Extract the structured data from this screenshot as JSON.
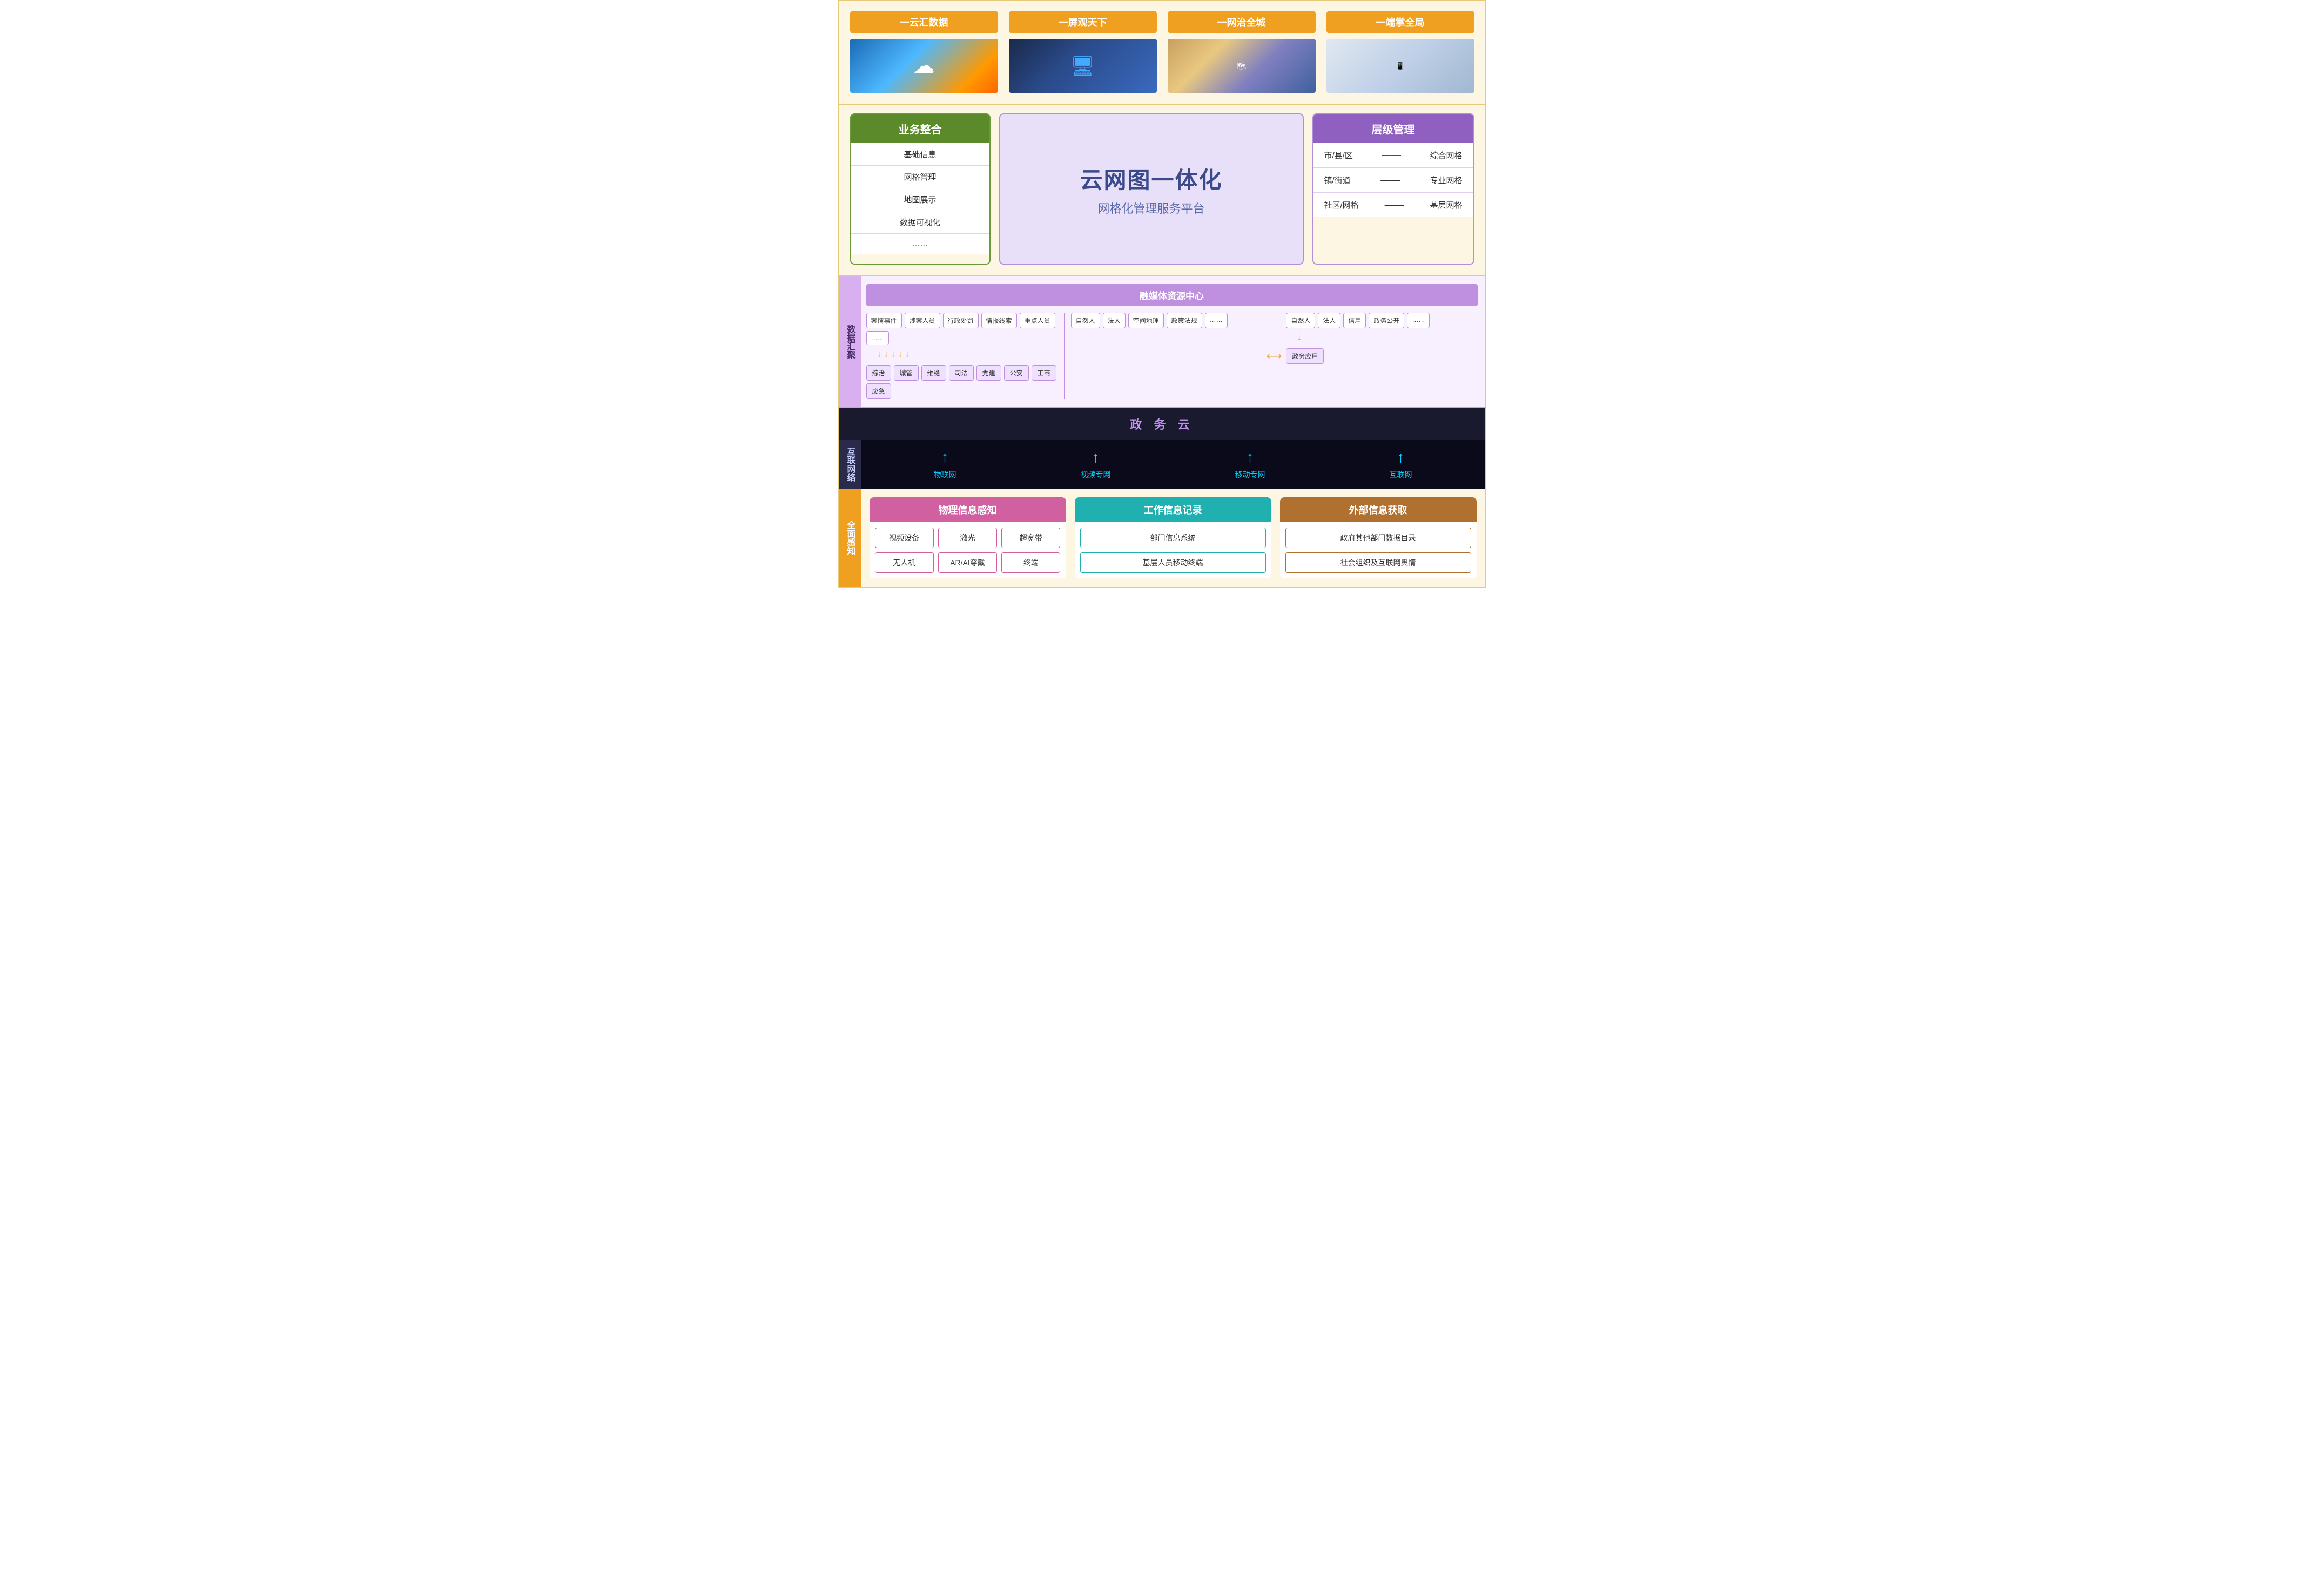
{
  "top": {
    "cards": [
      {
        "title": "一云汇数据",
        "img_type": "cloud"
      },
      {
        "title": "一屏观天下",
        "img_type": "screen"
      },
      {
        "title": "一网治全城",
        "img_type": "map"
      },
      {
        "title": "一端掌全局",
        "img_type": "mobile"
      }
    ]
  },
  "business": {
    "header": "业务整合",
    "items": [
      "基础信息",
      "网格管理",
      "地图展示",
      "数据可视化",
      "……"
    ]
  },
  "center": {
    "title_main": "云网图一体化",
    "title_sub": "网格化管理服务平台"
  },
  "level": {
    "header": "层级管理",
    "items": [
      {
        "left": "市/县/区",
        "dash": "——",
        "right": "综合网格"
      },
      {
        "left": "镇/街道",
        "dash": "——",
        "right": "专业网格"
      },
      {
        "left": "社区/网格",
        "dash": "——",
        "right": "基层网格"
      }
    ]
  },
  "data_section": {
    "label": "数据汇聚",
    "media_center": "融媒体资源中心",
    "left_tags": [
      "案情事件",
      "涉案人员",
      "行政处罚",
      "情报线索",
      "重点人员",
      "……"
    ],
    "left_apps": [
      "综治",
      "城管",
      "维稳",
      "司法",
      "党建",
      "公安",
      "工商",
      "应急"
    ],
    "right_tags_1": [
      "自然人",
      "法人",
      "空间地理",
      "政策法规",
      "……"
    ],
    "right_tags_2": [
      "自然人",
      "法人",
      "信用",
      "政务公开",
      "……"
    ],
    "right_app": "政务应用"
  },
  "cloud": {
    "title": "政 务 云"
  },
  "network": {
    "label": "互联网络",
    "items": [
      "物联网",
      "视频专网",
      "移动专网",
      "互联网"
    ]
  },
  "bottom": {
    "label": "全面感知",
    "physical": {
      "header": "物理信息感知",
      "rows": [
        [
          "视频设备",
          "激光",
          "超宽带"
        ],
        [
          "无人机",
          "AR/AI穿戴",
          "终端"
        ]
      ]
    },
    "work": {
      "header": "工作信息记录",
      "rows": [
        [
          "部门信息系统"
        ],
        [
          "基层人员移动终端"
        ]
      ]
    },
    "external": {
      "header": "外部信息获取",
      "rows": [
        [
          "政府其他部门数据目录"
        ],
        [
          "社会组织及互联网舆情"
        ]
      ]
    }
  }
}
